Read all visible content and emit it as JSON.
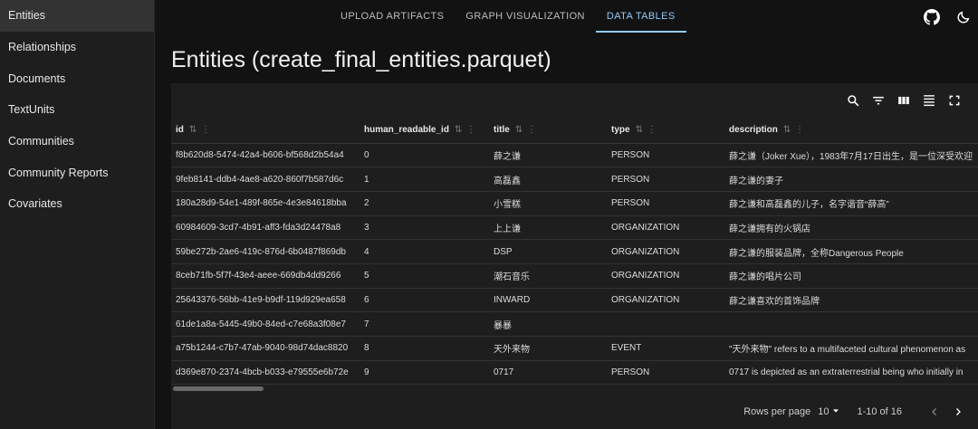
{
  "sidebar": {
    "items": [
      {
        "label": "Entities"
      },
      {
        "label": "Relationships"
      },
      {
        "label": "Documents"
      },
      {
        "label": "TextUnits"
      },
      {
        "label": "Communities"
      },
      {
        "label": "Community Reports"
      },
      {
        "label": "Covariates"
      }
    ]
  },
  "header": {
    "tabs": [
      {
        "label": "UPLOAD ARTIFACTS"
      },
      {
        "label": "GRAPH VISUALIZATION"
      },
      {
        "label": "DATA TABLES"
      }
    ],
    "icons": [
      "github-icon",
      "dark-mode-icon"
    ]
  },
  "page": {
    "title": "Entities (create_final_entities.parquet)"
  },
  "toolbar": {
    "icons": [
      "search-icon",
      "filter-icon",
      "columns-icon",
      "density-icon",
      "fullscreen-icon"
    ]
  },
  "table": {
    "columns": [
      {
        "label": "id"
      },
      {
        "label": "human_readable_id"
      },
      {
        "label": "title"
      },
      {
        "label": "type"
      },
      {
        "label": "description"
      }
    ],
    "rows": [
      [
        "f8b620d8-5474-42a4-b606-bf568d2b54a4",
        "0",
        "薛之谦",
        "PERSON",
        "薛之谦（Joker Xue），1983年7月17日出生，是一位深受欢迎"
      ],
      [
        "9feb8141-ddb4-4ae8-a620-860f7b587d6c",
        "1",
        "高磊鑫",
        "PERSON",
        "薛之谦的妻子"
      ],
      [
        "180a28d9-54e1-489f-865e-4e3e84618bba",
        "2",
        "小雪糕",
        "PERSON",
        "薛之谦和高磊鑫的儿子，名字谐音“薛高”"
      ],
      [
        "60984609-3cd7-4b91-aff3-fda3d24478a8",
        "3",
        "上上谦",
        "ORGANIZATION",
        "薛之谦拥有的火锅店"
      ],
      [
        "59be272b-2ae6-419c-876d-6b0487f869db",
        "4",
        "DSP",
        "ORGANIZATION",
        "薛之谦的服装品牌，全称Dangerous People"
      ],
      [
        "8ceb71fb-5f7f-43e4-aeee-669db4dd9266",
        "5",
        "潮石音乐",
        "ORGANIZATION",
        "薛之谦的唱片公司"
      ],
      [
        "25643376-56bb-41e9-b9df-119d929ea658",
        "6",
        "INWARD",
        "ORGANIZATION",
        "薛之谦喜欢的首饰品牌"
      ],
      [
        "61de1a8a-5445-49b0-84ed-c7e68a3f08e7",
        "7",
        "暴暴",
        "",
        ""
      ],
      [
        "a75b1244-c7b7-47ab-9040-98d74dac8820",
        "8",
        "天外来物",
        "EVENT",
        "\"天外来物\" refers to a multifaceted cultural phenomenon as"
      ],
      [
        "d369e870-2374-4bcb-b033-e79555e6b72e",
        "9",
        "0717",
        "PERSON",
        "0717 is depicted as an extraterrestrial being who initially in"
      ]
    ]
  },
  "pagination": {
    "rows_per_page_label": "Rows per page",
    "rows_per_page_value": "10",
    "range": "1-10 of 16"
  },
  "colors": {
    "accent": "#90caf9",
    "background": "#121212",
    "panel": "#1e1e1e"
  }
}
